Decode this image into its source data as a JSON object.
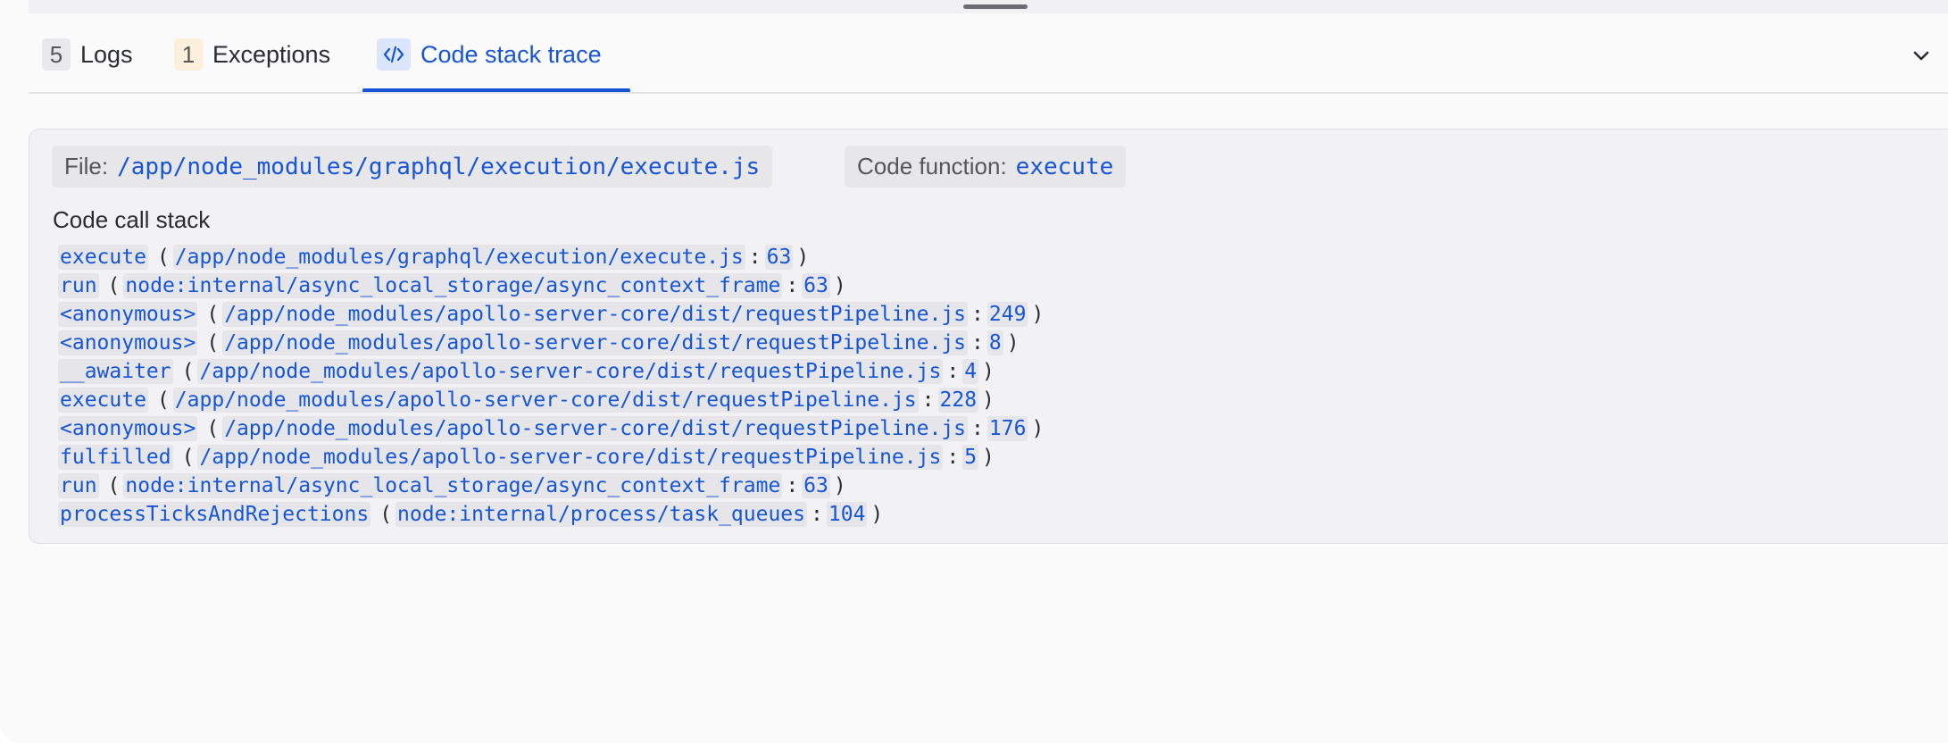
{
  "tabs": {
    "logs": {
      "count": "5",
      "label": "Logs"
    },
    "exceptions": {
      "count": "1",
      "label": "Exceptions"
    },
    "code_stack_trace": {
      "label": "Code stack trace"
    }
  },
  "icons": {
    "code": "code-icon",
    "collapse": "chevron-down-icon"
  },
  "colors": {
    "accent": "#1655d8",
    "exception_badge": "#fcf0dc"
  },
  "trace": {
    "file_label": "File:",
    "file_value": "/app/node_modules/graphql/execution/execute.js",
    "function_label": "Code function:",
    "function_value": "execute",
    "call_stack_heading": "Code call stack",
    "frames": [
      {
        "function": "execute",
        "file": "/app/node_modules/graphql/execution/execute.js",
        "line": "63"
      },
      {
        "function": "run",
        "file": "node:internal/async_local_storage/async_context_frame",
        "line": "63"
      },
      {
        "function": "<anonymous>",
        "file": "/app/node_modules/apollo-server-core/dist/requestPipeline.js",
        "line": "249"
      },
      {
        "function": "<anonymous>",
        "file": "/app/node_modules/apollo-server-core/dist/requestPipeline.js",
        "line": "8"
      },
      {
        "function": "__awaiter",
        "file": "/app/node_modules/apollo-server-core/dist/requestPipeline.js",
        "line": "4"
      },
      {
        "function": "execute",
        "file": "/app/node_modules/apollo-server-core/dist/requestPipeline.js",
        "line": "228"
      },
      {
        "function": "<anonymous>",
        "file": "/app/node_modules/apollo-server-core/dist/requestPipeline.js",
        "line": "176"
      },
      {
        "function": "fulfilled",
        "file": "/app/node_modules/apollo-server-core/dist/requestPipeline.js",
        "line": "5"
      },
      {
        "function": "run",
        "file": "node:internal/async_local_storage/async_context_frame",
        "line": "63"
      },
      {
        "function": "processTicksAndRejections",
        "file": "node:internal/process/task_queues",
        "line": "104"
      }
    ]
  }
}
